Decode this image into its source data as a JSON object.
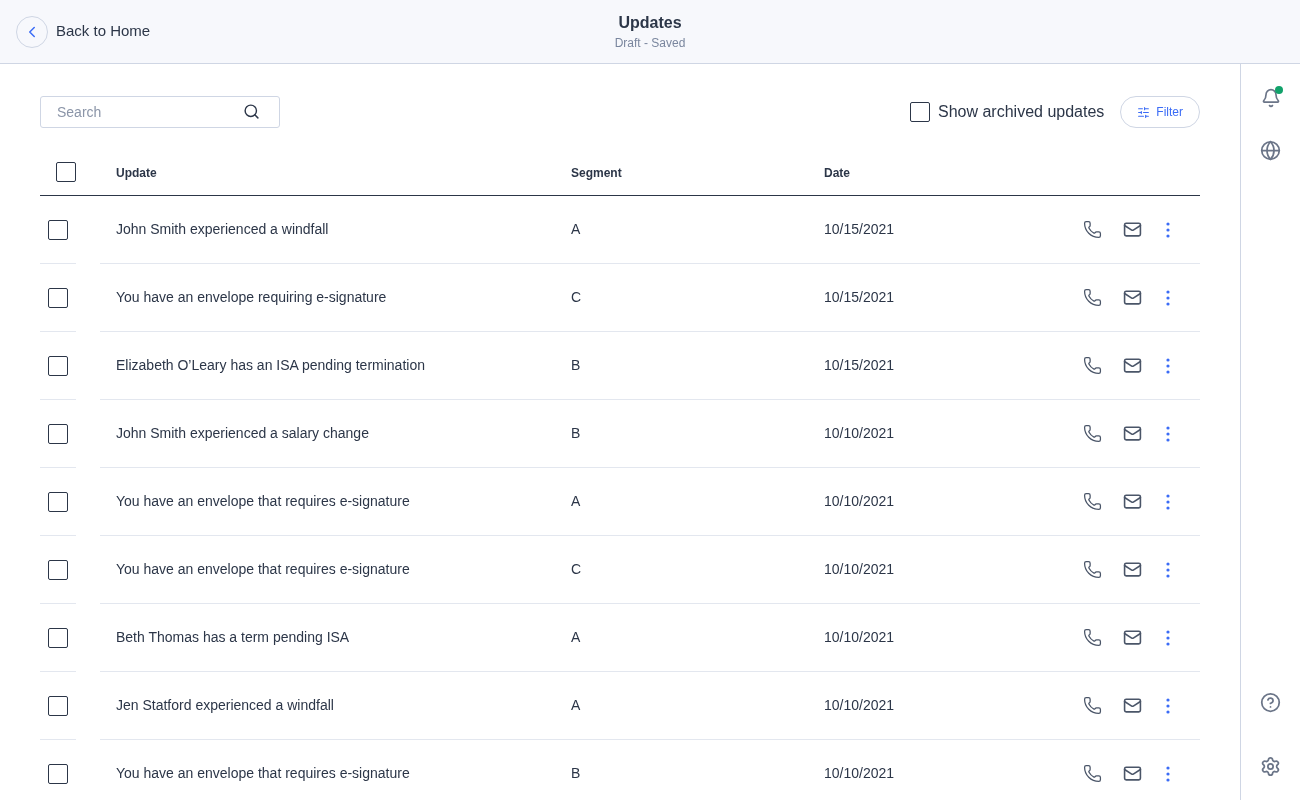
{
  "header": {
    "back_label": "Back to Home",
    "title": "Updates",
    "subtitle": "Draft - Saved"
  },
  "toolbar": {
    "search_placeholder": "Search",
    "show_archived": {
      "label": "Show archived updates",
      "checked": false
    },
    "filter_label": "Filter"
  },
  "table": {
    "select_all_checked": false,
    "columns": [
      "Update",
      "Segment",
      "Date"
    ],
    "rows": [
      {
        "checked": false,
        "update": "John Smith experienced a windfall",
        "segment": "A",
        "date": "10/15/2021"
      },
      {
        "checked": false,
        "update": "You have an envelope requiring e-signature",
        "segment": "C",
        "date": "10/15/2021"
      },
      {
        "checked": false,
        "update": "Elizabeth O’Leary has an ISA pending termination",
        "segment": "B",
        "date": "10/15/2021"
      },
      {
        "checked": false,
        "update": "John Smith experienced a salary change",
        "segment": "B",
        "date": "10/10/2021"
      },
      {
        "checked": false,
        "update": "You have an envelope that requires e-signature",
        "segment": "A",
        "date": "10/10/2021"
      },
      {
        "checked": false,
        "update": "You have an envelope that requires e-signature",
        "segment": "C",
        "date": "10/10/2021"
      },
      {
        "checked": false,
        "update": "Beth Thomas has a term pending ISA",
        "segment": "A",
        "date": "10/10/2021"
      },
      {
        "checked": false,
        "update": "Jen Statford experienced a windfall",
        "segment": "A",
        "date": "10/10/2021"
      },
      {
        "checked": false,
        "update": "You have an envelope that requires e-signature",
        "segment": "B",
        "date": "10/10/2021"
      }
    ]
  },
  "rail": {
    "unread_notifications": true
  }
}
